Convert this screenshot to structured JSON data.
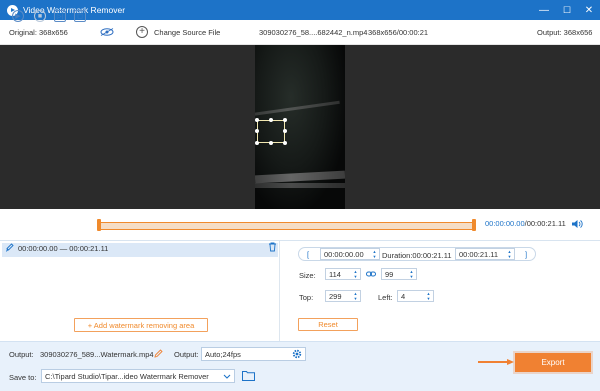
{
  "titlebar": {
    "app_title": "Video Watermark Remover",
    "minimize": "—",
    "maximize": "☐",
    "close": "✕"
  },
  "infobar": {
    "original": "Original: 368x656",
    "change_source": "Change Source File",
    "file_name": "309030276_58....682442_n.mp4",
    "file_meta": "368x656/00:00:21",
    "output": "Output: 368x656"
  },
  "timeline": {
    "current_time": "00:00:00.00",
    "total_time": "/00:00:21.11",
    "progress": 0
  },
  "area_list": {
    "item_range": "00:00:00.00 — 00:00:21.11",
    "add_button": "+ Add watermark removing area"
  },
  "settings": {
    "start_time": "00:00:00.00",
    "duration": "Duration:00:00:21.11",
    "end_time": "00:00:21.11",
    "size_label": "Size:",
    "width": "114",
    "height": "99",
    "top_label": "Top:",
    "top": "299",
    "left_label": "Left:",
    "left": "4",
    "reset": "Reset"
  },
  "bottom": {
    "output_label": "Output:",
    "output_file": "309030276_589...Watermark.mp4",
    "format_label": "Output:",
    "format_value": "Auto;24fps",
    "save_label": "Save to:",
    "save_path": "C:\\Tipard Studio\\Tipar...ideo Watermark Remover",
    "export": "Export"
  },
  "colors": {
    "accent": "#1d73c8",
    "export": "#f08132"
  },
  "icons": [
    "app-logo-icon",
    "eye-icon",
    "add-circle-icon",
    "play-icon",
    "stop-icon",
    "frame-forward-icon",
    "snapshot-icon",
    "volume-icon",
    "brush-icon",
    "trash-icon",
    "link-icon",
    "pencil-icon",
    "gear-icon",
    "chevron-down-icon",
    "folder-icon"
  ]
}
